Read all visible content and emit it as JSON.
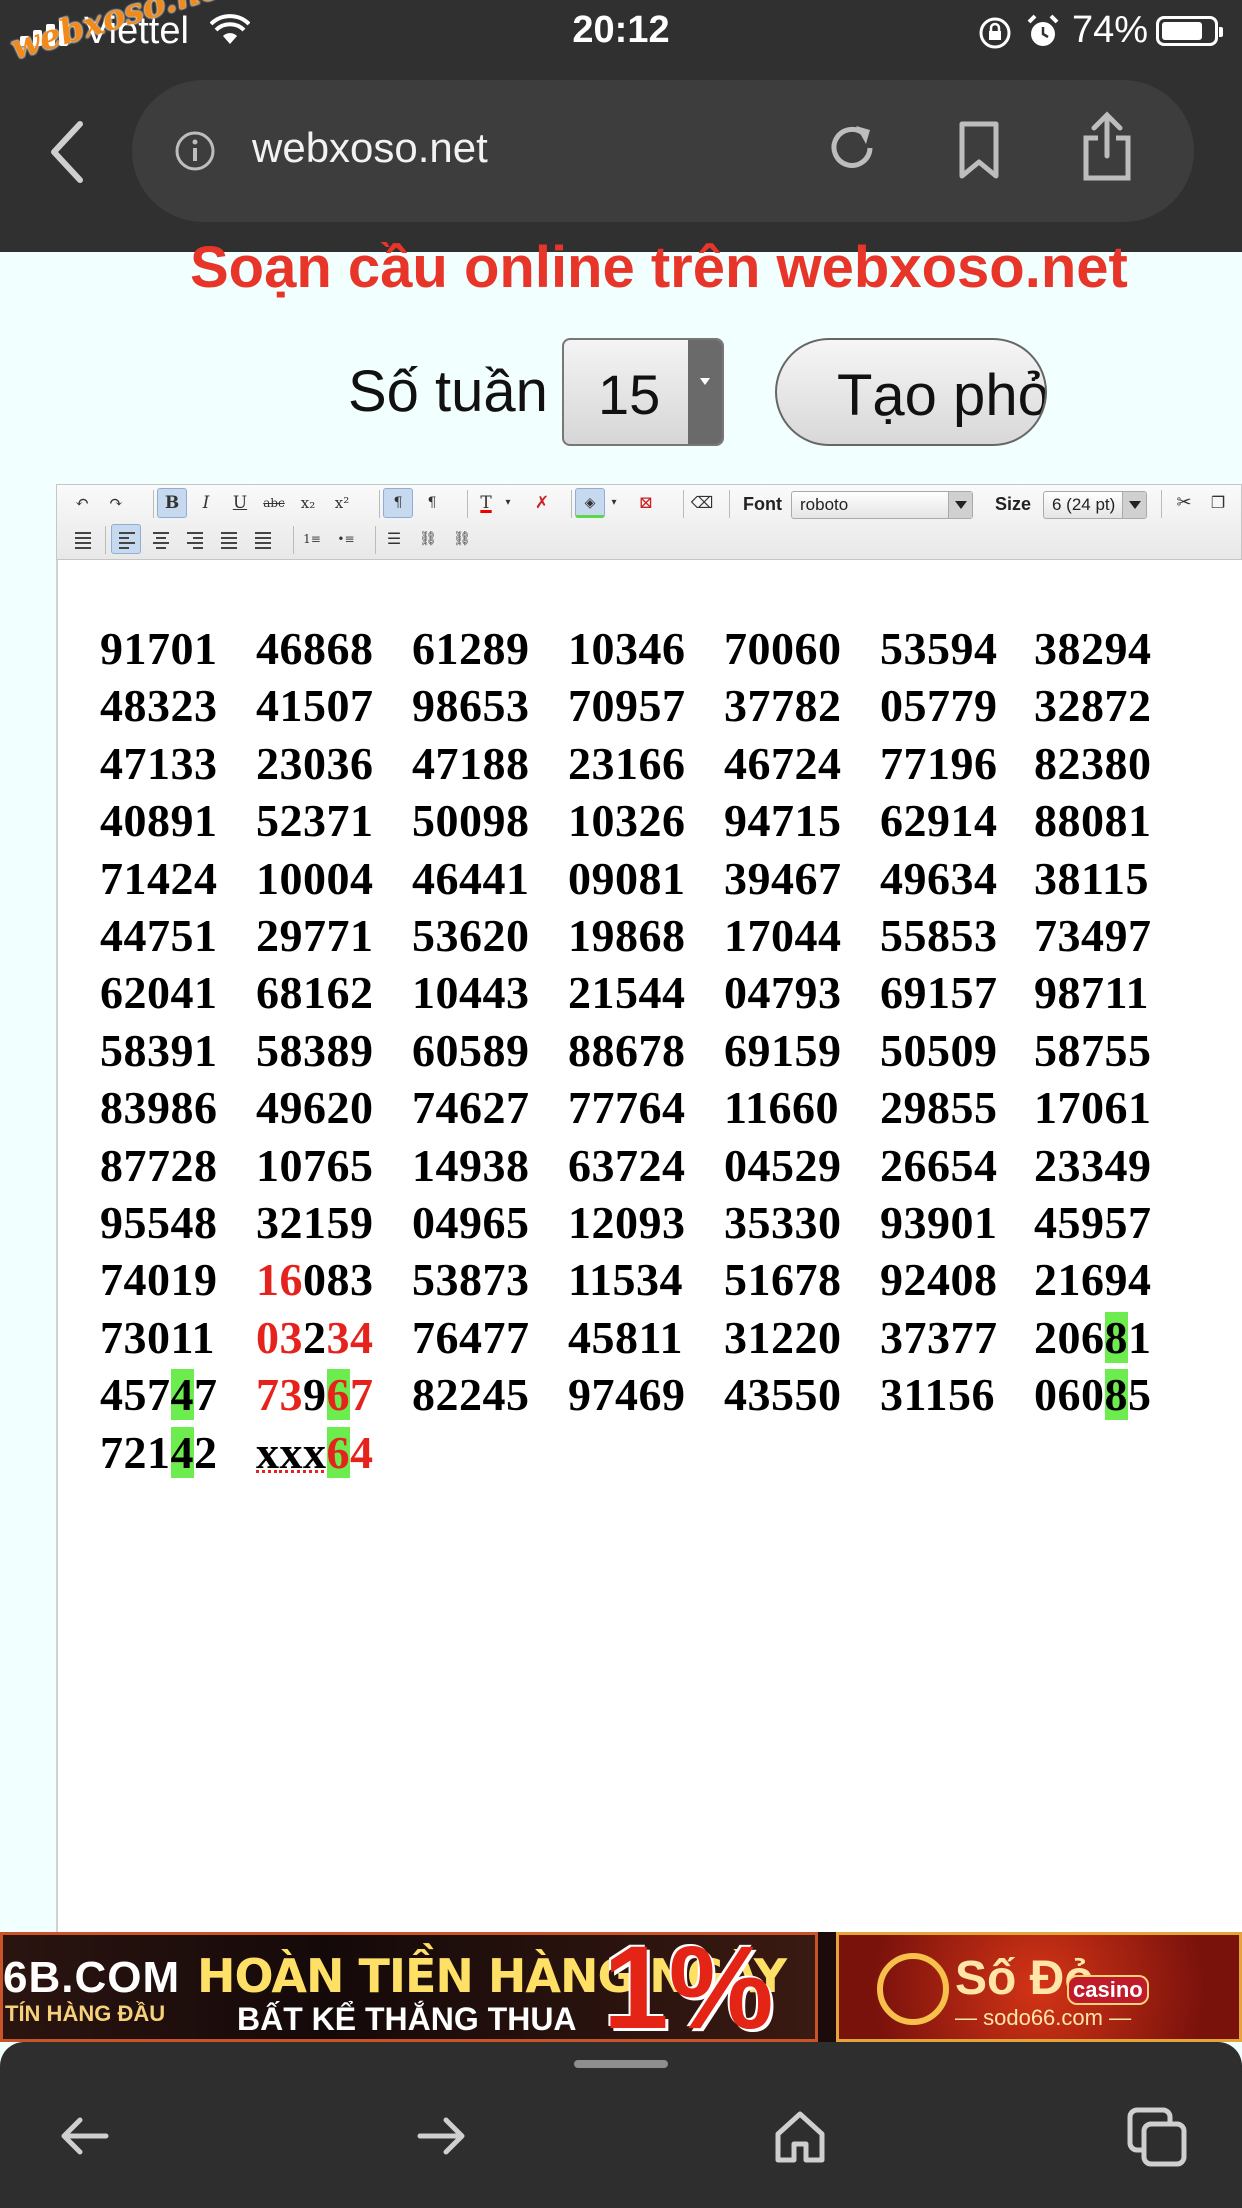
{
  "status_bar": {
    "carrier": "Viettel",
    "time": "20:12",
    "battery": "74%",
    "watermark": "webxoso.net"
  },
  "browser": {
    "url": "webxoso.net"
  },
  "page": {
    "title": "Soạn cầu online trên webxoso.net",
    "weeks_label": "Số tuần",
    "weeks_value": "15",
    "create_button": "Tạo phỏi"
  },
  "editor_toolbar": {
    "font_label": "Font",
    "font_value": "roboto",
    "size_label": "Size",
    "size_value": "6 (24 pt)"
  },
  "grid": [
    [
      "91701",
      "46868",
      "61289",
      "10346",
      "70060",
      "53594",
      "38294"
    ],
    [
      "48323",
      "41507",
      "98653",
      "70957",
      "37782",
      "05779",
      "32872"
    ],
    [
      "47133",
      "23036",
      "47188",
      "23166",
      "46724",
      "77196",
      "82380"
    ],
    [
      "40891",
      "52371",
      "50098",
      "10326",
      "94715",
      "62914",
      "88081"
    ],
    [
      "71424",
      "10004",
      "46441",
      "09081",
      "39467",
      "49634",
      "38115"
    ],
    [
      "44751",
      "29771",
      "53620",
      "19868",
      "17044",
      "55853",
      "73497"
    ],
    [
      "62041",
      "68162",
      "10443",
      "21544",
      "04793",
      "69157",
      "98711"
    ],
    [
      "58391",
      "58389",
      "60589",
      "88678",
      "69159",
      "50509",
      "58755"
    ],
    [
      "83986",
      "49620",
      "74627",
      "77764",
      "11660",
      "29855",
      "17061"
    ],
    [
      "87728",
      "10765",
      "14938",
      "63724",
      "04529",
      "26654",
      "23349"
    ],
    [
      "95548",
      "32159",
      "04965",
      "12093",
      "35330",
      "93901",
      "45957"
    ],
    [
      "74019",
      "16083",
      "53873",
      "11534",
      "51678",
      "92408",
      "21694"
    ],
    [
      "73011",
      "03234",
      "76477",
      "45811",
      "31220",
      "37377",
      "20681"
    ],
    [
      "45747",
      "73967",
      "82245",
      "97469",
      "43550",
      "31156",
      "06085"
    ],
    [
      "72142",
      "xxx64",
      "",
      "",
      "",
      "",
      ""
    ]
  ],
  "ad_banner": {
    "left_brand": "6B.COM",
    "left_brand_sub": "TÍN HÀNG ĐẦU",
    "headline": "HOÀN TIỀN HÀNG NGÀY",
    "subline": "BẤT KỂ THẮNG THUA",
    "percent": "1%",
    "right_name": "Số Đỏ",
    "right_badge": "casino",
    "right_site": "— sodo66.com —"
  },
  "colors": {
    "title_red": "#e8352a",
    "digit_red": "#e5221c",
    "highlight_green": "#6cec4e",
    "browser_chrome": "#303030"
  }
}
